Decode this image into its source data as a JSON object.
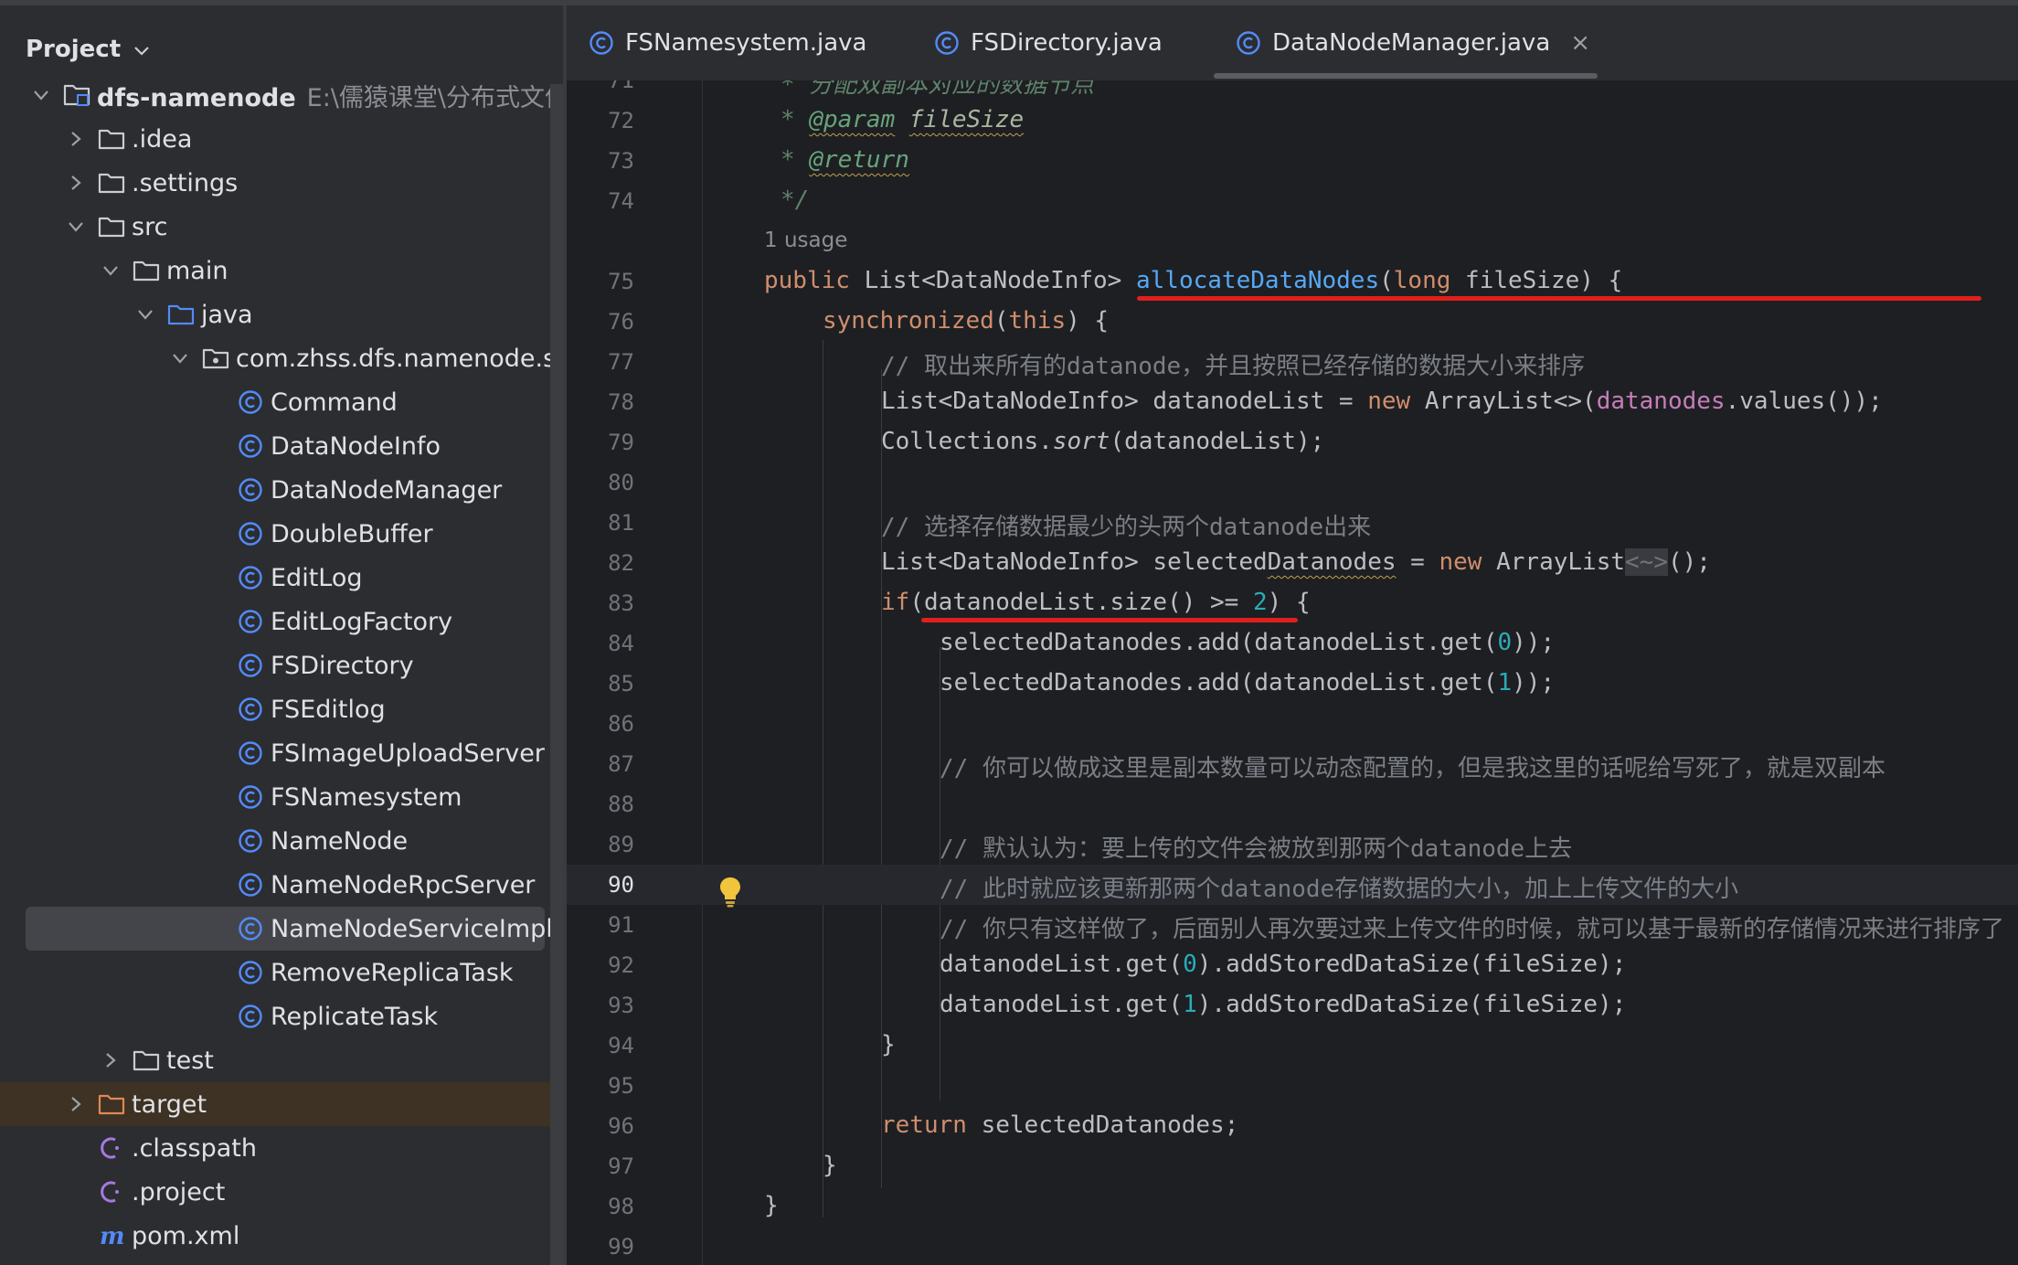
{
  "project_panel": {
    "title": "Project",
    "tree": [
      {
        "label": "dfs-namenode",
        "path": "E:\\儒猿课堂\\分布式文件系",
        "type": "module",
        "expanded": true,
        "bold": true
      },
      {
        "label": ".idea",
        "type": "folder",
        "expanded": false
      },
      {
        "label": ".settings",
        "type": "folder",
        "expanded": false
      },
      {
        "label": "src",
        "type": "folder",
        "expanded": true
      },
      {
        "label": "main",
        "type": "folder",
        "expanded": true
      },
      {
        "label": "java",
        "type": "source-folder",
        "expanded": true
      },
      {
        "label": "com.zhss.dfs.namenode.serv",
        "type": "package",
        "expanded": true
      },
      {
        "label": "Command",
        "type": "class"
      },
      {
        "label": "DataNodeInfo",
        "type": "class"
      },
      {
        "label": "DataNodeManager",
        "type": "class"
      },
      {
        "label": "DoubleBuffer",
        "type": "class"
      },
      {
        "label": "EditLog",
        "type": "class"
      },
      {
        "label": "EditLogFactory",
        "type": "class"
      },
      {
        "label": "FSDirectory",
        "type": "class"
      },
      {
        "label": "FSEditlog",
        "type": "class"
      },
      {
        "label": "FSImageUploadServer",
        "type": "class"
      },
      {
        "label": "FSNamesystem",
        "type": "class"
      },
      {
        "label": "NameNode",
        "type": "class"
      },
      {
        "label": "NameNodeRpcServer",
        "type": "class"
      },
      {
        "label": "NameNodeServiceImpl",
        "type": "class",
        "selected": true
      },
      {
        "label": "RemoveReplicaTask",
        "type": "class"
      },
      {
        "label": "ReplicateTask",
        "type": "class"
      },
      {
        "label": "test",
        "type": "folder",
        "expanded": false
      },
      {
        "label": "target",
        "type": "excluded-folder",
        "expanded": false
      },
      {
        "label": ".classpath",
        "type": "file"
      },
      {
        "label": ".project",
        "type": "file"
      },
      {
        "label": "pom.xml",
        "type": "maven-file"
      }
    ]
  },
  "tabs": [
    {
      "label": "FSNamesystem.java",
      "active": false
    },
    {
      "label": "FSDirectory.java",
      "active": false
    },
    {
      "label": "DataNodeManager.java",
      "active": true,
      "close": "×"
    }
  ],
  "editor": {
    "current_line": "90",
    "usage_hint": "1 usage",
    "lines": {
      "l71": {
        "num": "71",
        "a": "* 分配双副本对应的数据节点"
      },
      "l72": {
        "num": "72",
        "a": "* ",
        "b": "@param",
        "c": " ",
        "d": "fileSize"
      },
      "l73": {
        "num": "73",
        "a": "* ",
        "b": "@return"
      },
      "l74": {
        "num": "74",
        "a": "*/"
      },
      "l75": {
        "num": "75",
        "a": "public",
        "b": " List<DataNodeInfo> ",
        "c": "allocateDataNodes",
        "d": "(",
        "e": "long",
        "f": " fileSize) {"
      },
      "l76": {
        "num": "76",
        "a": "synchronized",
        "b": "(",
        "c": "this",
        "d": ") {"
      },
      "l77": {
        "num": "77",
        "a": "// 取出来所有的datanode，并且按照已经存储的数据大小来排序"
      },
      "l78": {
        "num": "78",
        "a": "List<DataNodeInfo> datanodeList = ",
        "b": "new",
        "c": " ArrayList<>(",
        "d": "datanodes",
        "e": ".values());"
      },
      "l79": {
        "num": "79",
        "a": "Collections.",
        "b": "sort",
        "c": "(datanodeList);"
      },
      "l80": {
        "num": "80"
      },
      "l81": {
        "num": "81",
        "a": "// 选择存储数据最少的头两个datanode出来"
      },
      "l82": {
        "num": "82",
        "a": "List<DataNodeInfo> selected",
        "b": "Datanodes",
        "c": " = ",
        "d": "new",
        "e": " ArrayList",
        "f": "<~>",
        "g": "();"
      },
      "l83": {
        "num": "83",
        "a": "if",
        "b": "(datanodeList.size() >= ",
        "c": "2",
        "d": ") {"
      },
      "l84": {
        "num": "84",
        "a": "selectedDatanodes.add(datanodeList.get(",
        "b": "0",
        "c": "));"
      },
      "l85": {
        "num": "85",
        "a": "selectedDatanodes.add(datanodeList.get(",
        "b": "1",
        "c": "));"
      },
      "l86": {
        "num": "86"
      },
      "l87": {
        "num": "87",
        "a": "// 你可以做成这里是副本数量可以动态配置的，但是我这里的话呢给写死了，就是双副本"
      },
      "l88": {
        "num": "88"
      },
      "l89": {
        "num": "89",
        "a": "// 默认认为：要上传的文件会被放到那两个datanode上去"
      },
      "l90": {
        "num": "90",
        "a": "// 此时就应该更新那两个datanode存储数据的大小，加上上传文件的大小"
      },
      "l91": {
        "num": "91",
        "a": "// 你只有这样做了，后面别人再次要过来上传文件的时候，就可以基于最新的存储情况来进行排序了"
      },
      "l92": {
        "num": "92",
        "a": "datanodeList.get(",
        "b": "0",
        "c": ").addStoredDataSize(fileSize);"
      },
      "l93": {
        "num": "93",
        "a": "datanodeList.get(",
        "b": "1",
        "c": ").addStoredDataSize(fileSize);"
      },
      "l94": {
        "num": "94",
        "a": "}"
      },
      "l95": {
        "num": "95"
      },
      "l96": {
        "num": "96",
        "a": "return",
        "b": " selectedDatanodes;"
      },
      "l97": {
        "num": "97",
        "a": "}"
      },
      "l98": {
        "num": "98",
        "a": "}"
      },
      "l99": {
        "num": "99"
      }
    }
  },
  "icons": {
    "folder": "folder-icon",
    "class": "class-icon",
    "bulb": "lightbulb-icon"
  },
  "colors": {
    "keyword": "#cf8e6d",
    "method": "#56a8f5",
    "comment": "#7a7e85",
    "number": "#2aacb8",
    "field": "#c77dbb",
    "annotation_underline": "#e0201c"
  }
}
